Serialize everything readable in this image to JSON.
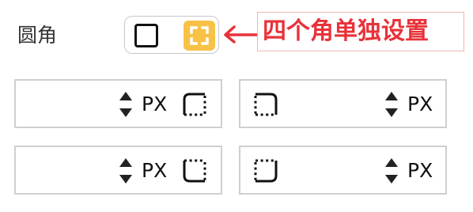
{
  "radius_row": {
    "label": "圆角",
    "modes": {
      "uniform_icon": "square-icon",
      "individual_icon": "corners-expand-icon",
      "selected": "individual",
      "accent_color": "#f7c246"
    }
  },
  "annotation": {
    "text": "四个角单独设置",
    "color": "#e8323a"
  },
  "corners": {
    "top_left": {
      "value": "",
      "unit": "PX",
      "icon": "corner-top-left-icon"
    },
    "top_right": {
      "value": "",
      "unit": "PX",
      "icon": "corner-top-right-icon"
    },
    "bottom_left": {
      "value": "",
      "unit": "PX",
      "icon": "corner-bottom-left-icon"
    },
    "bottom_right": {
      "value": "",
      "unit": "PX",
      "icon": "corner-bottom-right-icon"
    }
  }
}
